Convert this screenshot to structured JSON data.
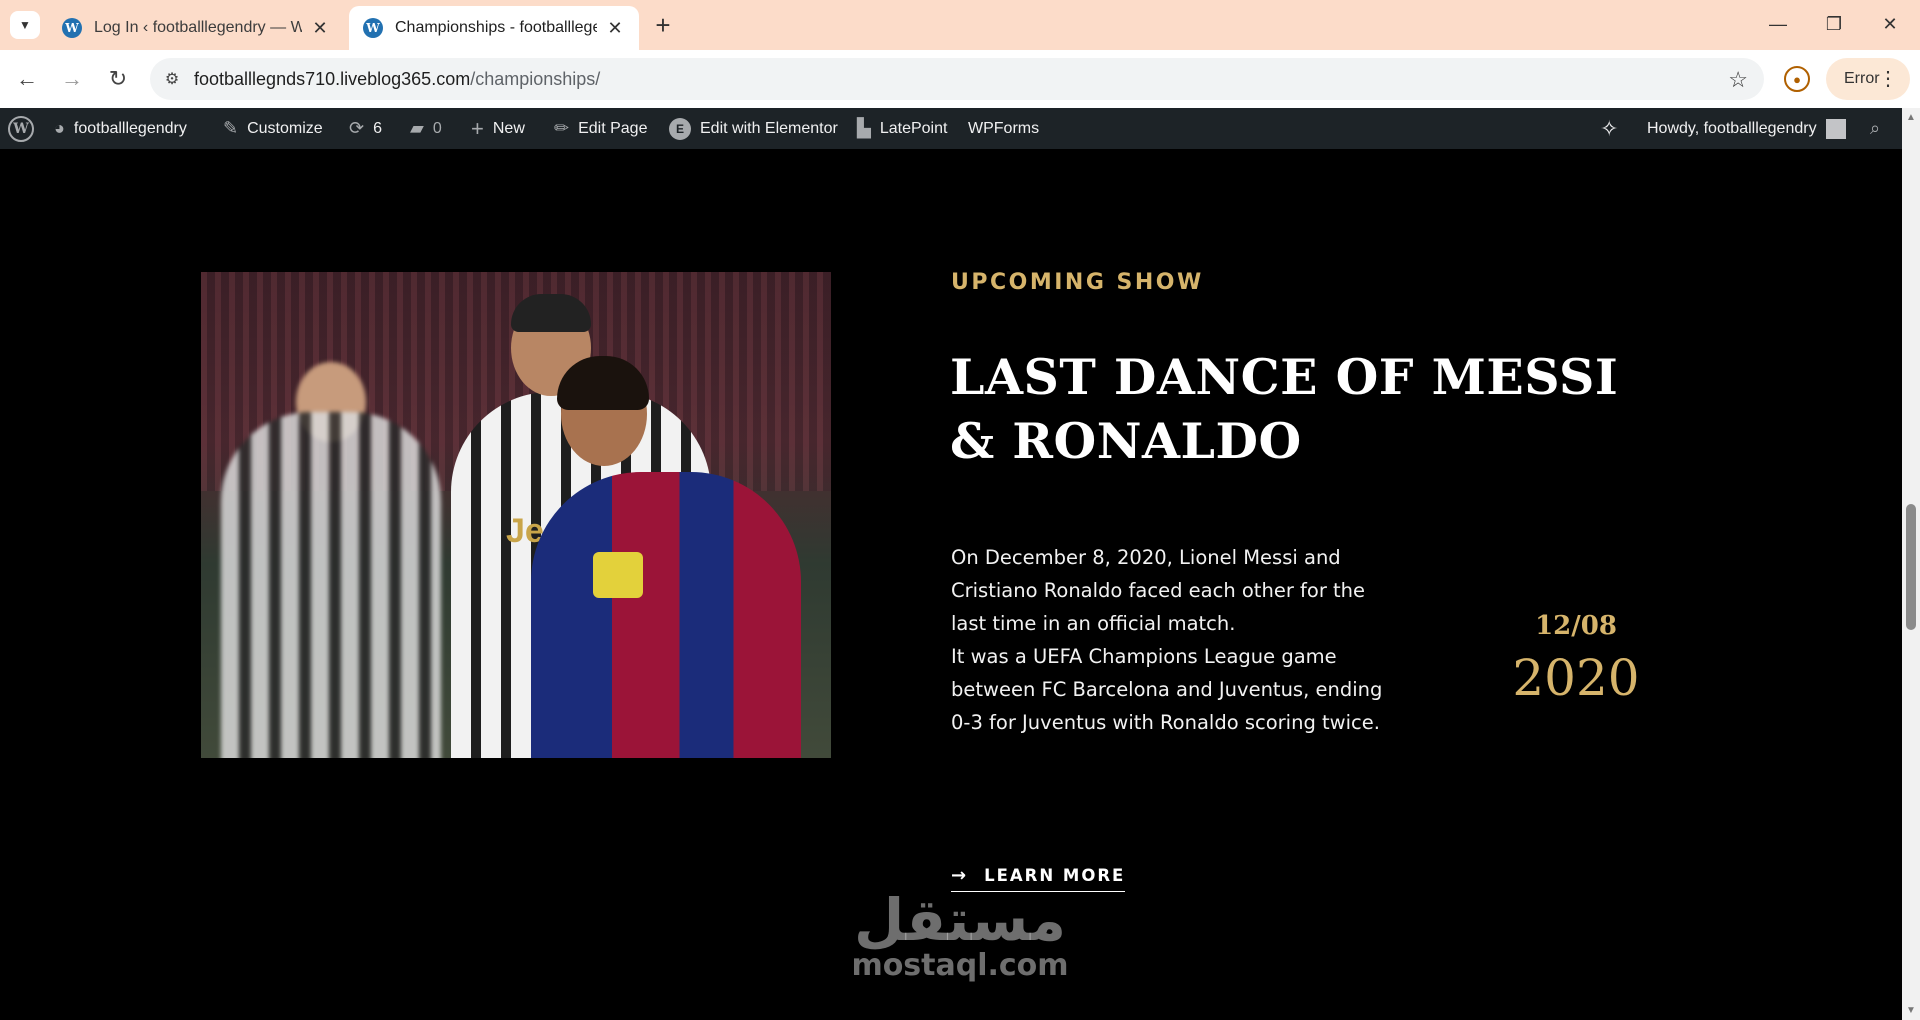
{
  "browser": {
    "tabs": [
      {
        "title": "Log In ‹ footballlegendry — Wo",
        "active": false
      },
      {
        "title": "Championships - footballlegenc",
        "active": true
      }
    ],
    "url_host": "footballlegnds710.liveblog365.com",
    "url_path": "/championships/",
    "error_label": "Error"
  },
  "adminbar": {
    "site_name": "footballlegendry",
    "customize": "Customize",
    "updates_count": "6",
    "comments_count": "0",
    "new": "New",
    "edit_page": "Edit Page",
    "edit_elementor": "Edit with Elementor",
    "latepoint": "LatePoint",
    "wpforms": "WPForms",
    "howdy": "Howdy, footballlegendry"
  },
  "content": {
    "kicker": "UPCOMING SHOW",
    "headline": "LAST DANCE OF MESSI & RONALDO",
    "paragraph_1": "On December 8, 2020, Lionel Messi and Cristiano Ronaldo faced each other for the last time in an official match.",
    "paragraph_2": "It was a UEFA Champions League game between FC Barcelona and Juventus, ending 0-3 for Juventus with Ronaldo scoring twice.",
    "date_day_month": "12/08",
    "date_year": "2020",
    "learn_more": "LEARN MORE",
    "accent_color": "#d6b46b"
  },
  "watermark": {
    "arabic": "مستقل",
    "latin": "mostaql.com"
  }
}
